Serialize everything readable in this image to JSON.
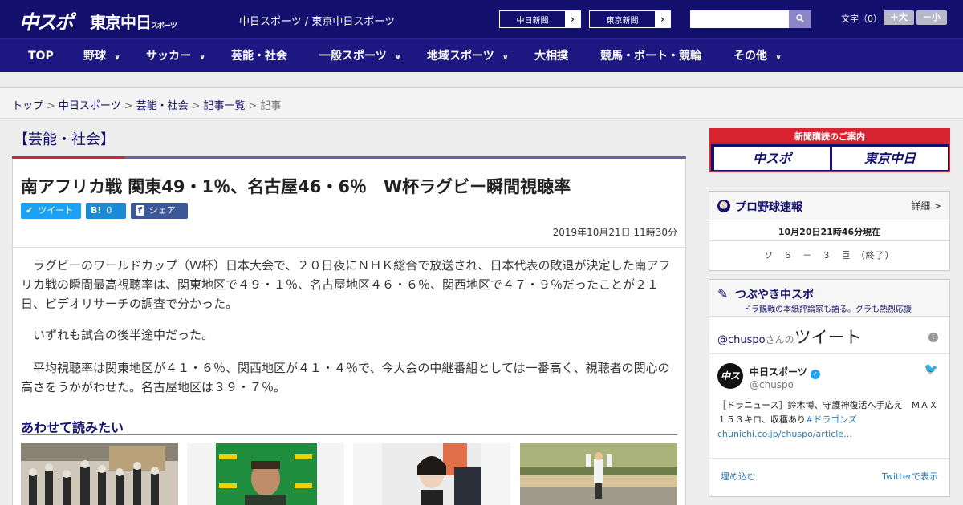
{
  "header": {
    "logo_chuspo": "中スポ",
    "logo_tokyo": "東京中日",
    "logo_tokyo_small": "スポーツ",
    "site_title": "中日スポーツ / 東京中日スポーツ",
    "paper_buttons": [
      "中日新聞",
      "東京新聞"
    ],
    "search_placeholder": "",
    "font_size_label": "文字（0）",
    "font_bigger": "＋大",
    "font_smaller": "－小"
  },
  "nav": {
    "items": [
      {
        "label": "TOP"
      },
      {
        "label": "野球"
      },
      {
        "label": "サッカー"
      },
      {
        "label": "芸能・社会"
      },
      {
        "label": "一般スポーツ"
      },
      {
        "label": "地域スポーツ"
      },
      {
        "label": "大相撲"
      },
      {
        "label": "競馬・ボート・競輪"
      },
      {
        "label": "その他"
      }
    ]
  },
  "breadcrumb": {
    "items": [
      "トップ",
      "中日スポーツ",
      "芸能・社会",
      "記事一覧"
    ],
    "current": "記事",
    "separator": ">"
  },
  "section_title": "【芸能・社会】",
  "article": {
    "headline": "南アフリカ戦 関東49・1％、名古屋46・6％　W杯ラグビー瞬間視聴率",
    "share": {
      "tweet": "ツイート",
      "hatena_count": "0",
      "facebook": "シェア 0"
    },
    "date": "2019年10月21日 11時30分",
    "paragraphs": [
      "　ラグビーのワールドカップ（Ｗ杯）日本大会で、２０日夜にＮＨＫ総合で放送され、日本代表の敗退が決定した南アフリカ戦の瞬間最高視聴率は、関東地区で４９・１％、名古屋地区４６・６％、関西地区で４７・９％だったことが２１日、ビデオリサーチの調査で分かった。",
      "　いずれも試合の後半途中だった。",
      "　平均視聴率は関東地区が４１・６％、関西地区が４１・４％で、今大会の中継番組としては一番高く、視聴者の関心の高さをうかがわせた。名古屋地区は３９・７％。"
    ],
    "related_title": "あわせて読みたい"
  },
  "sidebar": {
    "ad": {
      "top": "新聞購読のご案内",
      "logo_left": "中スポ",
      "logo_right": "東京中日"
    },
    "baseball": {
      "title": "プロ野球速報",
      "detail": "詳細 >",
      "time": "10月20日21時46分現在",
      "score": "ソ　６　－　３　巨　（終了）"
    },
    "tsubuyaki": {
      "title": "つぶやき中スポ",
      "subtitle": "ドラ観戦の本紙評論家も語る。グラも熱烈応援",
      "head_handle": "@chuspo",
      "head_san": "さんの",
      "head_tweet": "ツイート",
      "user_name": "中日スポーツ",
      "user_handle": "@chuspo",
      "tweet_text": "［ドラニュース］鈴木博、守護神復活へ手応え　ＭＡＸ１５３キロ、収穫あり",
      "tweet_link": "#ドラゴンズchunichi.co.jp/chuspo/article…",
      "embed": "埋め込む",
      "view_on_twitter": "Twitterで表示"
    }
  },
  "colors": {
    "brand_navy": "#14106e",
    "accent_red": "#d6232f",
    "twitter_blue": "#1da1f2"
  }
}
